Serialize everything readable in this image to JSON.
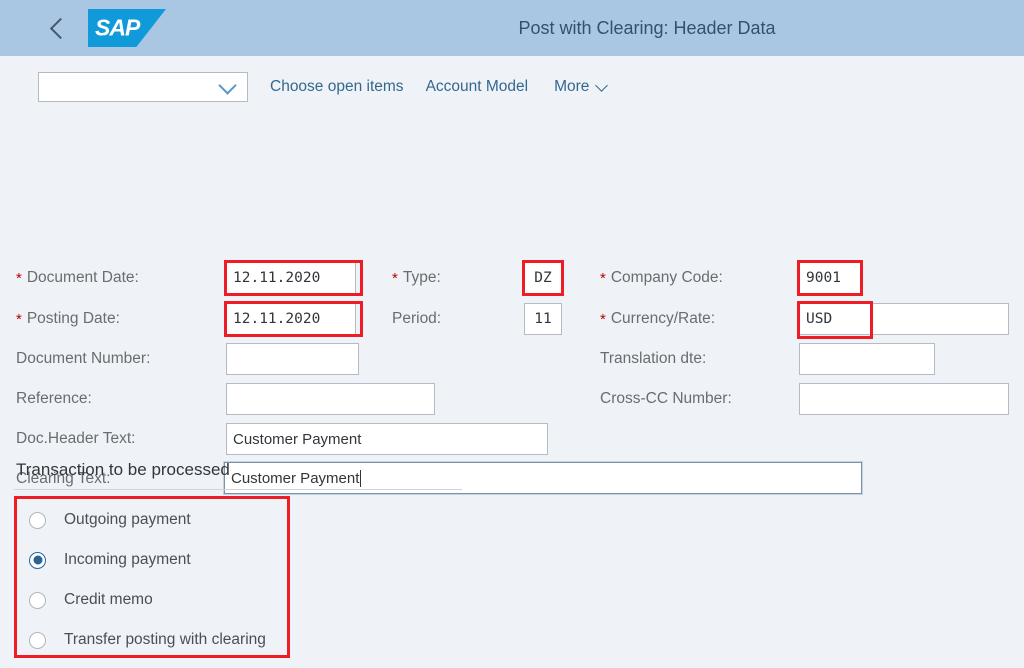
{
  "header": {
    "back_icon": "back-chevron-icon",
    "logo_text": "SAP",
    "title": "Post with Clearing: Header Data"
  },
  "toolbar": {
    "select_value": "",
    "select_placeholder": "",
    "chevron_icon": "chevron-down-icon",
    "links": [
      {
        "label": "Choose open items"
      },
      {
        "label": "Account Model"
      },
      {
        "label": "More",
        "has_chevron": true
      }
    ]
  },
  "form": {
    "col1": [
      {
        "label": "Document Date:",
        "required": true,
        "value": "12.11.2020",
        "highlighted": true
      },
      {
        "label": "Posting Date:",
        "required": true,
        "value": "12.11.2020",
        "highlighted": true
      },
      {
        "label": "Document Number:",
        "required": false,
        "value": "",
        "highlighted": false
      },
      {
        "label": "Reference:",
        "required": false,
        "value": "",
        "highlighted": false
      },
      {
        "label": "Doc.Header Text:",
        "required": false,
        "value": "Customer Payment",
        "highlighted": false
      },
      {
        "label": "Clearing Text:",
        "required": false,
        "value": "Customer Payment",
        "highlighted": false,
        "focused": true
      }
    ],
    "col2": [
      {
        "label": "Type:",
        "required": true,
        "value": "DZ",
        "highlighted": true
      },
      {
        "label": "Period:",
        "required": false,
        "value": "11",
        "highlighted": false
      }
    ],
    "col3": [
      {
        "label": "Company Code:",
        "required": true,
        "value": "9001",
        "highlighted": true
      },
      {
        "label": "Currency/Rate:",
        "required": true,
        "value": "USD",
        "highlighted": true,
        "rate_value": ""
      },
      {
        "label": "Translation dte:",
        "required": false,
        "value": "",
        "highlighted": false
      },
      {
        "label": "Cross-CC Number:",
        "required": false,
        "value": "",
        "highlighted": false
      }
    ]
  },
  "transaction_section": {
    "title": "Transaction to be processed",
    "highlighted": true,
    "options": [
      {
        "label": "Outgoing payment",
        "selected": false
      },
      {
        "label": "Incoming payment",
        "selected": true
      },
      {
        "label": "Credit memo",
        "selected": false
      },
      {
        "label": "Transfer posting with clearing",
        "selected": false
      }
    ]
  },
  "colors": {
    "shell_header_bg": "#a9c7e3",
    "body_bg": "#eff3f7",
    "link": "#33688f",
    "annotation": "#ee1c25",
    "radio_selected": "#2a6496",
    "required_asterisk": "#bb0000",
    "sap_blue": "#109ada"
  }
}
